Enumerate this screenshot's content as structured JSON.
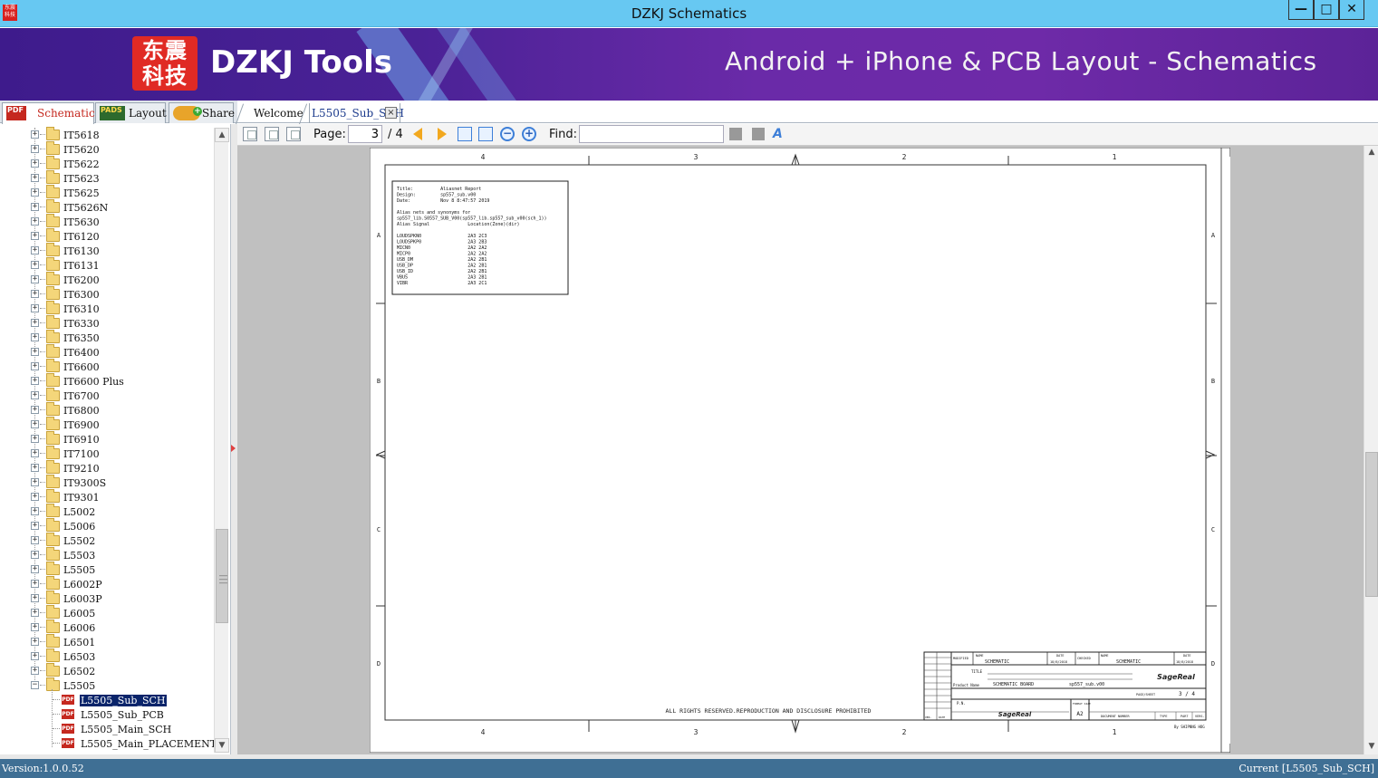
{
  "window": {
    "title": "DZKJ Schematics",
    "minimize_glyph": "—",
    "maximize_glyph": "□",
    "close_glyph": "✕",
    "app_icon_text": "东震科技"
  },
  "banner": {
    "logo_text": "东震\n科技",
    "brand": "DZKJ Tools",
    "tagline": "Android + iPhone & PCB Layout - Schematics",
    "colors": {
      "start": "#3e1b8c",
      "end": "#6e2aa8",
      "logo": "#e02a24"
    }
  },
  "left_tabs": [
    {
      "label": "Schematic",
      "icon": "pdf-icon",
      "active": true
    },
    {
      "label": "Layout",
      "icon": "pads-icon",
      "active": false
    },
    {
      "label": "Share",
      "icon": "cloud-share-icon",
      "active": false
    }
  ],
  "doc_tabs": [
    {
      "label": "Welcome",
      "active": false
    },
    {
      "label": "L5505_Sub_SCH",
      "active": true,
      "closable": true
    }
  ],
  "tree": {
    "folders": [
      "IT5618",
      "IT5620",
      "IT5622",
      "IT5623",
      "IT5625",
      "IT5626N",
      "IT5630",
      "IT6120",
      "IT6130",
      "IT6131",
      "IT6200",
      "IT6300",
      "IT6310",
      "IT6330",
      "IT6350",
      "IT6400",
      "IT6600",
      "IT6600 Plus",
      "IT6700",
      "IT6800",
      "IT6900",
      "IT6910",
      "IT7100",
      "IT9210",
      "IT9300S",
      "IT9301",
      "L5002",
      "L5006",
      "L5502",
      "L5503",
      "L5505",
      "L6002P",
      "L6003P",
      "L6005",
      "L6006",
      "L6501",
      "L6503",
      "L6502"
    ],
    "expanded_folder": "L5505",
    "files": [
      {
        "label": "L5505_Sub_SCH",
        "selected": true
      },
      {
        "label": "L5505_Sub_PCB",
        "selected": false
      },
      {
        "label": "L5505_Main_SCH",
        "selected": false
      },
      {
        "label": "L5505_Main_PLACEMENT",
        "selected": false
      }
    ],
    "expander_plus": "+",
    "expander_minus": "−"
  },
  "toolbar": {
    "page_label": "Page:",
    "page_value": "3",
    "page_total": "/ 4",
    "find_label": "Find:",
    "find_value": "",
    "zoom_out_glyph": "−",
    "zoom_in_glyph": "+",
    "text_tool_glyph": "A"
  },
  "sheet": {
    "columns": [
      "4",
      "3",
      "2",
      "1"
    ],
    "rows": [
      "A",
      "B",
      "C",
      "D"
    ],
    "report_lines": [
      "Title:          Aliasnet Report",
      "Design:         sp557_sub.v00",
      "Date:           Nov 8 8:47:57 2019",
      "",
      "Alias nets and synonyms for",
      "sp557_lib.S0557_SUB_V00(sp557_lib.sp557_sub_v00(sch_1))",
      "Alias Signal              Location(Zone)(dir)",
      "",
      "LOUDSPKN0                 2A3 2C3",
      "LOUDSPKP0                 2A3 2B3",
      "MICN0                     2A2 2A2",
      "MICP0                     2A2 2A2",
      "USB_DM                    2A2 2B1",
      "USB_DP                    2A2 2B1",
      "USB_ID                    2A2 2B1",
      "VBUS                      2A3 2B1",
      "VIBR                      2A3 2C1"
    ],
    "rights_text": "ALL RIGHTS RESERVED.REPRODUCTION AND DISCLOSURE PROHIBITED",
    "title_block": {
      "modified": "MODIFIED",
      "name_label": "NAME",
      "name_value": "SCHEMATIC",
      "date_label": "DATE",
      "date_value": "18/8/2018",
      "checked": "CHECKED",
      "checked_name": "SCHEMATIC",
      "checked_date": "18/8/2018",
      "title_label": "TITLE",
      "product_label": "Product Name",
      "product_value": "SCHEMATIC BOARD",
      "product_file": "sp557_sub.v00",
      "pn_label": "P.N.",
      "format_label": "FORMAT SIZE",
      "format_value": "A2",
      "doc_number_label": "DOCUMENT NUMBER",
      "type_label": "TYPE",
      "part_label": "PART",
      "vers_label": "VERS.",
      "page_sheet_label": "PAGE/SHEET",
      "page_sheet_value": "3 / 4",
      "ver_label": "VER.",
      "date_small": "DATE",
      "company": "SageReal",
      "footer": "By SHIPNNG HOG"
    }
  },
  "status": {
    "version": "Version:1.0.0.52",
    "current": "Current [L5505_Sub_SCH]"
  }
}
